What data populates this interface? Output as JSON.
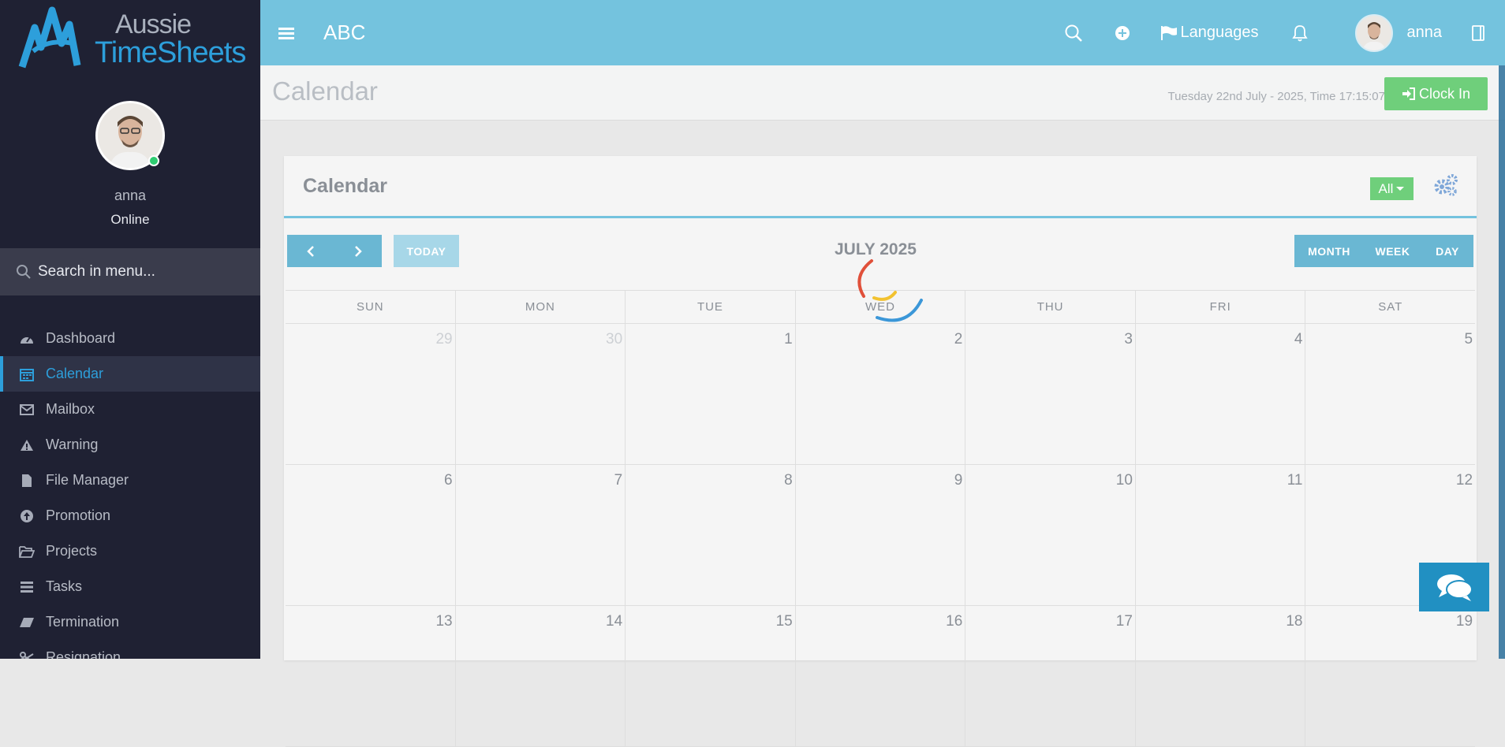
{
  "brand": {
    "line1": "Aussie",
    "line2": "TimeSheets"
  },
  "profile": {
    "name": "anna",
    "status": "Online"
  },
  "menu_search": {
    "placeholder": "Search in menu..."
  },
  "menu": [
    {
      "label": "Dashboard",
      "icon": "dashboard-icon",
      "active": false
    },
    {
      "label": "Calendar",
      "icon": "calendar-icon",
      "active": true
    },
    {
      "label": "Mailbox",
      "icon": "envelope-icon",
      "active": false
    },
    {
      "label": "Warning",
      "icon": "warning-icon",
      "active": false
    },
    {
      "label": "File Manager",
      "icon": "file-icon",
      "active": false
    },
    {
      "label": "Promotion",
      "icon": "arrow-up-circle-icon",
      "active": false
    },
    {
      "label": "Projects",
      "icon": "folder-open-icon",
      "active": false
    },
    {
      "label": "Tasks",
      "icon": "tasks-icon",
      "active": false
    },
    {
      "label": "Termination",
      "icon": "eraser-icon",
      "active": false
    },
    {
      "label": "Resignation",
      "icon": "scissors-icon",
      "active": false
    }
  ],
  "topbar": {
    "title": "ABC",
    "languages_label": "Languages",
    "user_name": "anna"
  },
  "header": {
    "page_title": "Calendar",
    "datetime": "Tuesday 22nd July - 2025,  Time  17:15:07",
    "clock_in_label": "Clock In"
  },
  "card": {
    "title": "Calendar",
    "filter_label": "All",
    "today_label": "TODAY",
    "month_title": "JULY 2025",
    "views": [
      "MONTH",
      "WEEK",
      "DAY"
    ],
    "days_of_week": [
      "SUN",
      "MON",
      "TUE",
      "WED",
      "THU",
      "FRI",
      "SAT"
    ],
    "weeks": [
      [
        {
          "d": "29",
          "other": true
        },
        {
          "d": "30",
          "other": true
        },
        {
          "d": "1"
        },
        {
          "d": "2"
        },
        {
          "d": "3"
        },
        {
          "d": "4"
        },
        {
          "d": "5"
        }
      ],
      [
        {
          "d": "6"
        },
        {
          "d": "7"
        },
        {
          "d": "8"
        },
        {
          "d": "9"
        },
        {
          "d": "10"
        },
        {
          "d": "11"
        },
        {
          "d": "12"
        }
      ],
      [
        {
          "d": "13"
        },
        {
          "d": "14"
        },
        {
          "d": "15"
        },
        {
          "d": "16"
        },
        {
          "d": "17"
        },
        {
          "d": "18"
        },
        {
          "d": "19"
        }
      ]
    ]
  },
  "colors": {
    "topbar": "#74c3de",
    "sidebar": "#1f2133",
    "accent": "#2d9fdb",
    "success": "#6fcf7b"
  }
}
